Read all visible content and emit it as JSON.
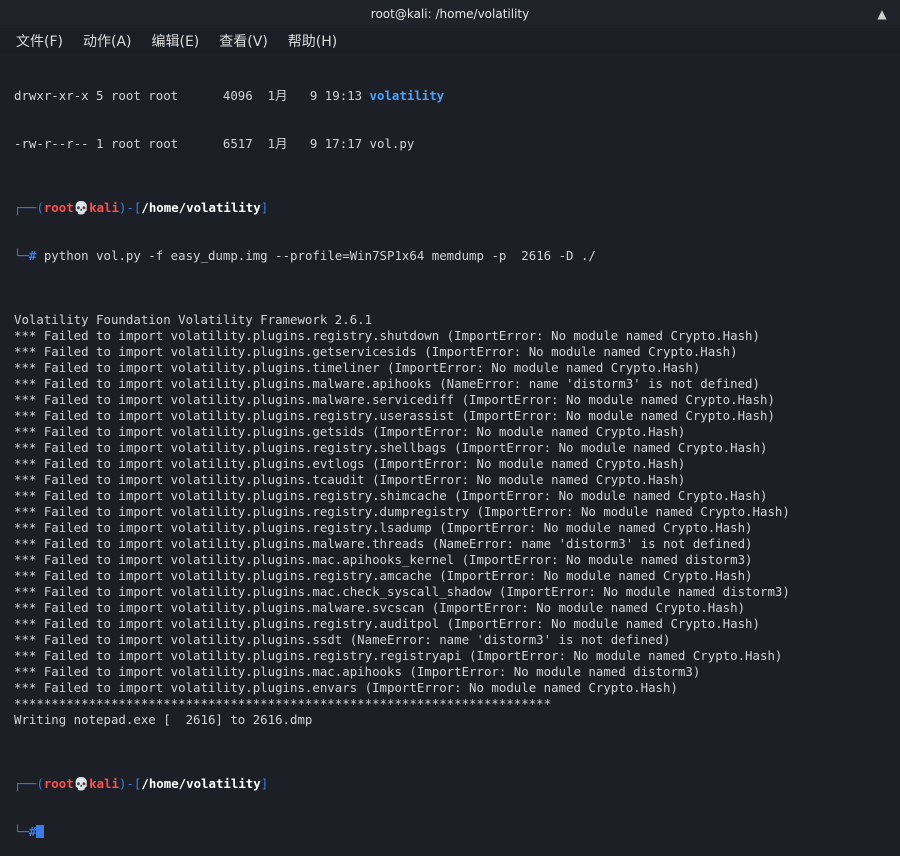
{
  "window": {
    "title": "root@kali: /home/volatility"
  },
  "menu": [
    {
      "label": "文件(F)"
    },
    {
      "label": "动作(A)"
    },
    {
      "label": "编辑(E)"
    },
    {
      "label": "查看(V)"
    },
    {
      "label": "帮助(H)"
    }
  ],
  "terminal": {
    "ls_lines": [
      {
        "prefix": "drwxr-xr-x 5 root root      4096  1月   9 19:13 ",
        "name": "volatility"
      },
      {
        "prefix": "-rw-r--r-- 1 root root      6517  1月   9 17:17 ",
        "name": "vol.py"
      }
    ],
    "prompt1": {
      "user": "root",
      "skull": "💀",
      "host": "kali",
      "path": "/home/volatility",
      "hash": "#",
      "command": " python vol.py -f easy_dump.img --profile=Win7SP1x64 memdump -p  2616 -D ./"
    },
    "output_lines": [
      "Volatility Foundation Volatility Framework 2.6.1",
      "*** Failed to import volatility.plugins.registry.shutdown (ImportError: No module named Crypto.Hash)",
      "*** Failed to import volatility.plugins.getservicesids (ImportError: No module named Crypto.Hash)",
      "*** Failed to import volatility.plugins.timeliner (ImportError: No module named Crypto.Hash)",
      "*** Failed to import volatility.plugins.malware.apihooks (NameError: name 'distorm3' is not defined)",
      "*** Failed to import volatility.plugins.malware.servicediff (ImportError: No module named Crypto.Hash)",
      "*** Failed to import volatility.plugins.registry.userassist (ImportError: No module named Crypto.Hash)",
      "*** Failed to import volatility.plugins.getsids (ImportError: No module named Crypto.Hash)",
      "*** Failed to import volatility.plugins.registry.shellbags (ImportError: No module named Crypto.Hash)",
      "*** Failed to import volatility.plugins.evtlogs (ImportError: No module named Crypto.Hash)",
      "*** Failed to import volatility.plugins.tcaudit (ImportError: No module named Crypto.Hash)",
      "*** Failed to import volatility.plugins.registry.shimcache (ImportError: No module named Crypto.Hash)",
      "*** Failed to import volatility.plugins.registry.dumpregistry (ImportError: No module named Crypto.Hash)",
      "*** Failed to import volatility.plugins.registry.lsadump (ImportError: No module named Crypto.Hash)",
      "*** Failed to import volatility.plugins.malware.threads (NameError: name 'distorm3' is not defined)",
      "*** Failed to import volatility.plugins.mac.apihooks_kernel (ImportError: No module named distorm3)",
      "*** Failed to import volatility.plugins.registry.amcache (ImportError: No module named Crypto.Hash)",
      "*** Failed to import volatility.plugins.mac.check_syscall_shadow (ImportError: No module named distorm3)",
      "*** Failed to import volatility.plugins.malware.svcscan (ImportError: No module named Crypto.Hash)",
      "*** Failed to import volatility.plugins.registry.auditpol (ImportError: No module named Crypto.Hash)",
      "*** Failed to import volatility.plugins.ssdt (NameError: name 'distorm3' is not defined)",
      "*** Failed to import volatility.plugins.registry.registryapi (ImportError: No module named Crypto.Hash)",
      "*** Failed to import volatility.plugins.mac.apihooks (ImportError: No module named distorm3)",
      "*** Failed to import volatility.plugins.envars (ImportError: No module named Crypto.Hash)",
      "************************************************************************",
      "Writing notepad.exe [  2616] to 2616.dmp"
    ],
    "prompt2": {
      "user": "root",
      "skull": "💀",
      "host": "kali",
      "path": "/home/volatility",
      "hash": "#"
    }
  },
  "icons": {
    "chevron": "chevron-up-icon"
  },
  "colors": {
    "prompt_frame": "#3d7be6",
    "root": "#ff4d4d",
    "dir": "#4aa3ff",
    "background": "#1c1f26"
  }
}
